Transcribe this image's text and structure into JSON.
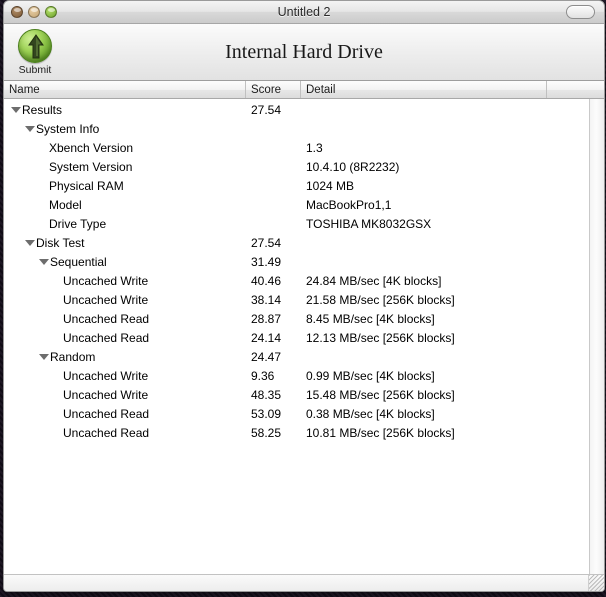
{
  "window": {
    "title": "Untitled 2",
    "controls": {
      "close_label": "close",
      "minimize_label": "minimize",
      "zoom_label": "zoom",
      "toolbar_toggle_label": "toolbar-toggle"
    }
  },
  "toolbar": {
    "submit_label": "Submit",
    "submit_icon": "submit-arrow-icon",
    "center_title": "Internal Hard Drive"
  },
  "table": {
    "columns": [
      {
        "key": "name",
        "label": "Name"
      },
      {
        "key": "score",
        "label": "Score"
      },
      {
        "key": "detail",
        "label": "Detail"
      },
      {
        "key": "pad",
        "label": ""
      }
    ],
    "rows": [
      {
        "level": 0,
        "disclosure": "open",
        "name": "Results",
        "score": "27.54",
        "detail": ""
      },
      {
        "level": 1,
        "disclosure": "open",
        "name": "System Info",
        "score": "",
        "detail": ""
      },
      {
        "level": 2,
        "disclosure": "none",
        "name": "Xbench Version",
        "score": "",
        "detail": "1.3"
      },
      {
        "level": 2,
        "disclosure": "none",
        "name": "System Version",
        "score": "",
        "detail": "10.4.10 (8R2232)"
      },
      {
        "level": 2,
        "disclosure": "none",
        "name": "Physical RAM",
        "score": "",
        "detail": "1024 MB"
      },
      {
        "level": 2,
        "disclosure": "none",
        "name": "Model",
        "score": "",
        "detail": "MacBookPro1,1"
      },
      {
        "level": 2,
        "disclosure": "none",
        "name": "Drive Type",
        "score": "",
        "detail": "TOSHIBA MK8032GSX"
      },
      {
        "level": 1,
        "disclosure": "open",
        "name": "Disk Test",
        "score": "27.54",
        "detail": ""
      },
      {
        "level": 2,
        "disclosure": "open",
        "name": "Sequential",
        "score": "31.49",
        "detail": ""
      },
      {
        "level": 3,
        "disclosure": "none",
        "name": "Uncached Write",
        "score": "40.46",
        "detail": "24.84 MB/sec [4K blocks]"
      },
      {
        "level": 3,
        "disclosure": "none",
        "name": "Uncached Write",
        "score": "38.14",
        "detail": "21.58 MB/sec [256K blocks]"
      },
      {
        "level": 3,
        "disclosure": "none",
        "name": "Uncached Read",
        "score": "28.87",
        "detail": "8.45 MB/sec [4K blocks]"
      },
      {
        "level": 3,
        "disclosure": "none",
        "name": "Uncached Read",
        "score": "24.14",
        "detail": "12.13 MB/sec [256K blocks]"
      },
      {
        "level": 2,
        "disclosure": "open",
        "name": "Random",
        "score": "24.47",
        "detail": ""
      },
      {
        "level": 3,
        "disclosure": "none",
        "name": "Uncached Write",
        "score": "9.36",
        "detail": "0.99 MB/sec [4K blocks]"
      },
      {
        "level": 3,
        "disclosure": "none",
        "name": "Uncached Write",
        "score": "48.35",
        "detail": "15.48 MB/sec [256K blocks]"
      },
      {
        "level": 3,
        "disclosure": "none",
        "name": "Uncached Read",
        "score": "53.09",
        "detail": "0.38 MB/sec [4K blocks]"
      },
      {
        "level": 3,
        "disclosure": "none",
        "name": "Uncached Read",
        "score": "58.25",
        "detail": "10.81 MB/sec [256K blocks]"
      }
    ]
  },
  "scrollbars": {
    "vertical_label": "vertical-scrollbar",
    "horizontal_label": "horizontal-scrollbar",
    "resize_grip_label": "resize-grip"
  },
  "colors": {
    "submit_green": "#6ca32c",
    "close_button": "#7d5a36",
    "minimize_button": "#c2a272",
    "zoom_button": "#6ca32c",
    "window_chrome": "#ececec",
    "table_background": "#ffffff"
  }
}
